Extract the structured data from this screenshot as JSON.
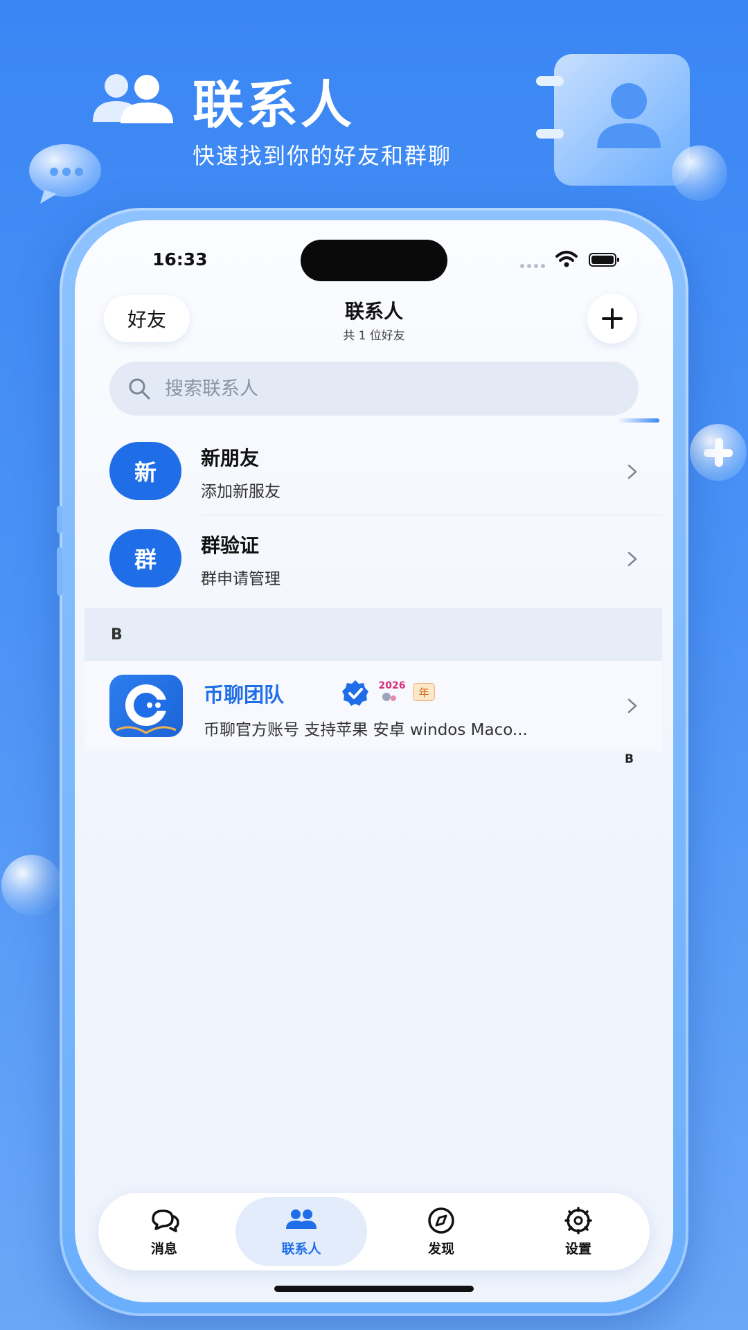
{
  "promo": {
    "title": "联系人",
    "subtitle": "快速找到你的好友和群聊"
  },
  "status_bar": {
    "time": "16:33"
  },
  "header": {
    "friends_label": "好友",
    "title": "联系人",
    "subtitle": "共 1 位好友",
    "add_icon": "plus-icon"
  },
  "search": {
    "placeholder": "搜索联系人"
  },
  "entries": [
    {
      "avatar_text": "新",
      "title": "新朋友",
      "desc": "添加新服友"
    },
    {
      "avatar_text": "群",
      "title": "群验证",
      "desc": "群申请管理"
    }
  ],
  "section": {
    "letter": "B"
  },
  "contact": {
    "name": "币聊团队",
    "badge": "年",
    "badge_art_text": "2026",
    "desc": "币聊官方账号 支持苹果 安卓 windos Maco..."
  },
  "index": {
    "letter": "B"
  },
  "tabs": [
    {
      "label": "消息",
      "icon": "chat-icon",
      "active": false
    },
    {
      "label": "联系人",
      "icon": "contacts-icon",
      "active": true
    },
    {
      "label": "发现",
      "icon": "compass-icon",
      "active": false
    },
    {
      "label": "设置",
      "icon": "gear-icon",
      "active": false
    }
  ],
  "colors": {
    "background": "#3a86f4",
    "accent": "#1f6ee8",
    "active_tab_bg": "#e2ecfb"
  }
}
